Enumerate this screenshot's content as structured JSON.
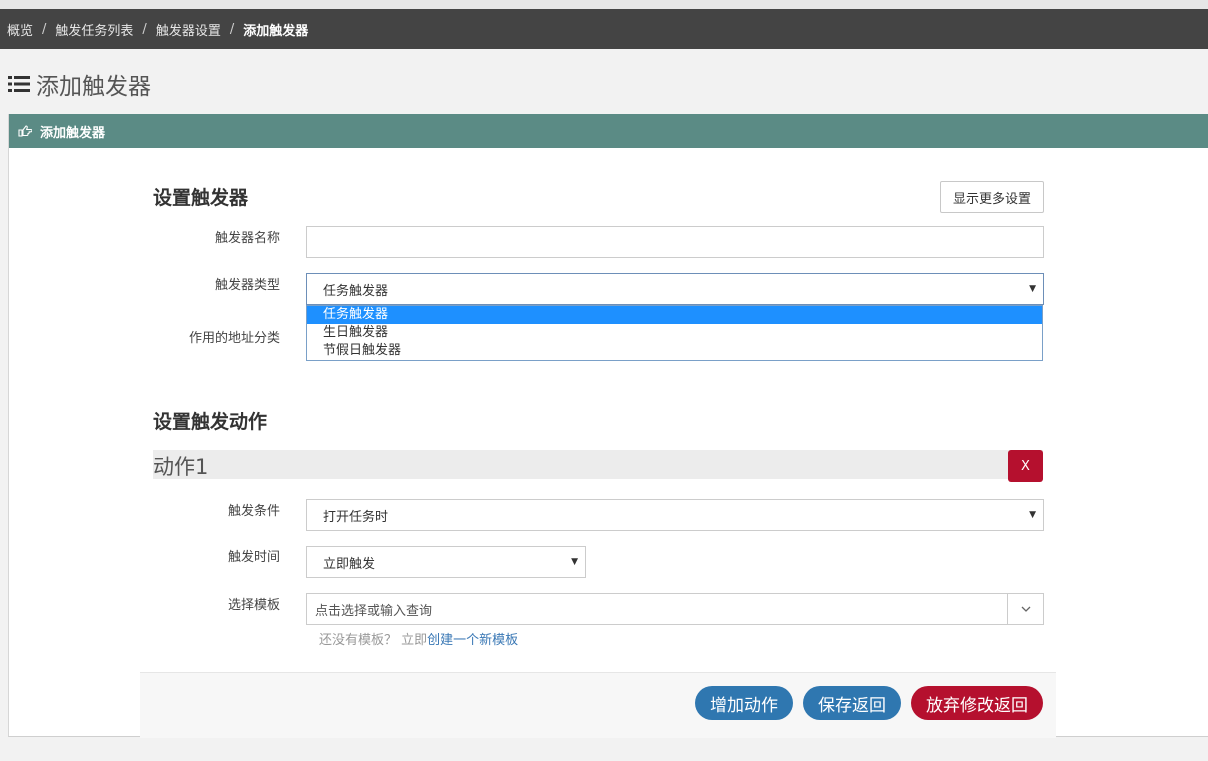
{
  "breadcrumb": {
    "items": [
      "概览",
      "触发任务列表",
      "触发器设置",
      "添加触发器"
    ],
    "separator": "/"
  },
  "page": {
    "title": "添加触发器",
    "title_icon": "list-icon"
  },
  "panel": {
    "header": "添加触发器",
    "header_icon": "hand-point-right-icon"
  },
  "trigger_section": {
    "title": "设置触发器",
    "more_settings_button": "显示更多设置",
    "name_label": "触发器名称",
    "name_value": "",
    "type_label": "触发器类型",
    "type_value": "任务触发器",
    "type_options": [
      "任务触发器",
      "生日触发器",
      "节假日触发器"
    ],
    "address_label": "作用的地址分类"
  },
  "action_section": {
    "title": "设置触发动作",
    "action_name": "动作1",
    "remove_button": "X",
    "condition_label": "触发条件",
    "condition_value": "打开任务时",
    "time_label": "触发时间",
    "time_value": "立即触发",
    "template_label": "选择模板",
    "template_placeholder": "点击选择或输入查询",
    "hint_text": "还没有模板？ 立即",
    "hint_link": "创建一个新模板"
  },
  "footer": {
    "add_action": "增加动作",
    "save_return": "保存返回",
    "discard_return": "放弃修改返回"
  },
  "colors": {
    "breadcrumb_bg": "#444444",
    "panel_header": "#5b8b85",
    "primary": "#2f77b0",
    "danger": "#b5102e",
    "selected_option": "#1e90ff"
  }
}
